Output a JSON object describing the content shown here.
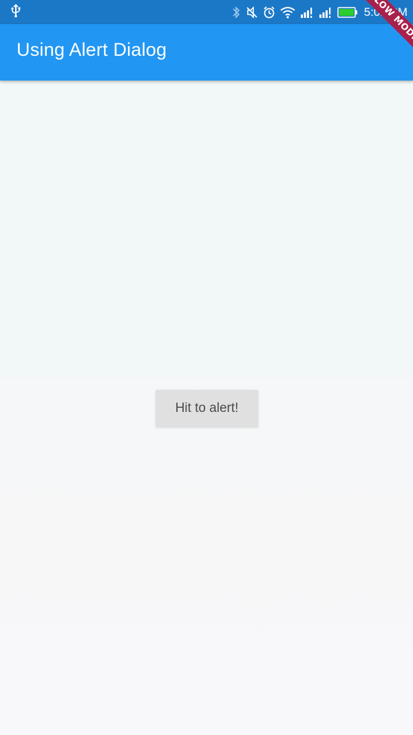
{
  "status_bar": {
    "time": "5:02 PM",
    "icons": [
      "usb-icon",
      "bluetooth-icon",
      "mute-icon",
      "alarm-icon",
      "wifi-icon",
      "signal-icon",
      "signal-r-icon",
      "battery-icon"
    ],
    "battery_color": "#2ecc2e"
  },
  "debug_banner": {
    "label": "SLOW MODE"
  },
  "app_bar": {
    "title": "Using Alert Dialog",
    "color": "#2196f3"
  },
  "main": {
    "button_label": "Hit to alert!"
  }
}
